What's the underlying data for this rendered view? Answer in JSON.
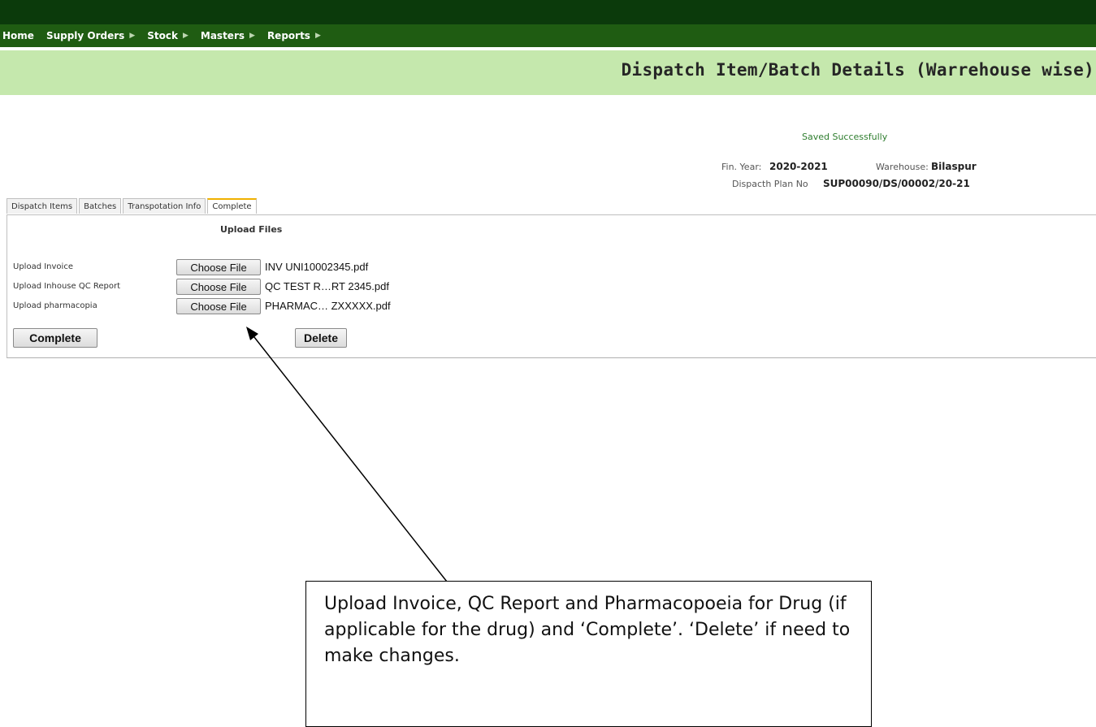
{
  "nav": {
    "items": [
      {
        "label": "Home",
        "has_submenu": false
      },
      {
        "label": "Supply Orders",
        "has_submenu": true
      },
      {
        "label": "Stock",
        "has_submenu": true
      },
      {
        "label": "Masters",
        "has_submenu": true
      },
      {
        "label": "Reports",
        "has_submenu": true
      }
    ]
  },
  "page": {
    "title": "Dispatch Item/Batch Details (Warrehouse wise)",
    "status_message": "Saved Successfully"
  },
  "info": {
    "fin_year_label": "Fin. Year:",
    "fin_year_value": "2020-2021",
    "warehouse_label": "Warehouse:",
    "warehouse_value": "Bilaspur",
    "plan_label": "Dispacth Plan No",
    "plan_value": "SUP00090/DS/00002/20-21"
  },
  "tabs": [
    {
      "label": "Dispatch Items",
      "active": false
    },
    {
      "label": "Batches",
      "active": false
    },
    {
      "label": "Transpotation Info",
      "active": false
    },
    {
      "label": "Complete",
      "active": true
    }
  ],
  "upload": {
    "title": "Upload Files",
    "rows": [
      {
        "label": "Upload Invoice",
        "button": "Choose File",
        "file": "INV UNI10002345.pdf"
      },
      {
        "label": "Upload Inhouse QC Report",
        "button": "Choose File",
        "file": "QC TEST R…RT 2345.pdf"
      },
      {
        "label": "Upload pharmacopia",
        "button": "Choose File",
        "file": "PHARMAC… ZXXXXX.pdf"
      }
    ],
    "complete_label": "Complete",
    "delete_label": "Delete"
  },
  "callout": {
    "text": "Upload Invoice, QC Report and Pharmacopoeia for Drug (if applicable for the drug) and ‘Complete’. ‘Delete’ if need to make changes."
  },
  "colors": {
    "top_band": "#0b3a0b",
    "nav_bar": "#1f5c12",
    "header_band": "#c5e8ad",
    "status_green": "#2e7d2e",
    "active_tab_accent": "#f0b000"
  }
}
